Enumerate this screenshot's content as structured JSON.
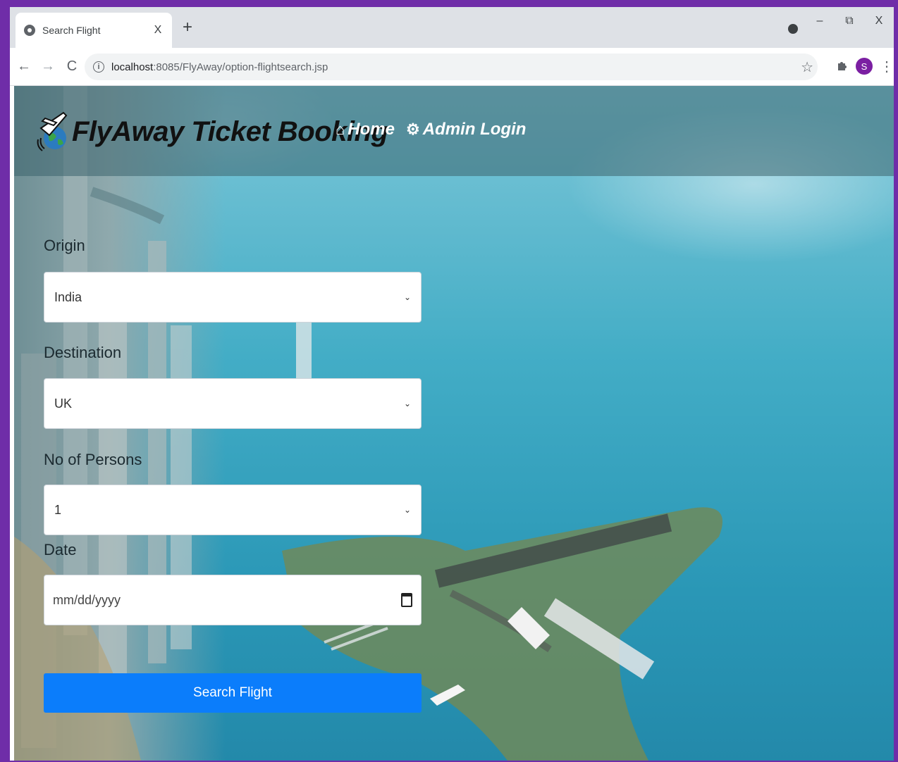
{
  "browser": {
    "tab_title": "Search Flight",
    "tab_close": "X",
    "new_tab": "+",
    "url_host": "localhost",
    "url_path": ":8085/FlyAway/option-flightsearch.jsp",
    "avatar_letter": "S",
    "window_controls": {
      "minimize": "–",
      "restore": "⧉",
      "close": "X"
    },
    "nav": {
      "back": "←",
      "forward": "→",
      "reload": "C"
    }
  },
  "header": {
    "brand": "FlyAway Ticket Booking",
    "links": [
      {
        "icon": "home-icon",
        "label": "Home"
      },
      {
        "icon": "gear-icon",
        "label": "Admin Login"
      }
    ]
  },
  "form": {
    "origin": {
      "label": "Origin",
      "value": "India"
    },
    "destination": {
      "label": "Destination",
      "value": "UK"
    },
    "persons": {
      "label": "No of Persons",
      "value": "1"
    },
    "date": {
      "label": "Date",
      "placeholder": "mm/dd/yyyy"
    },
    "submit_label": "Search Flight"
  },
  "colors": {
    "frame": "#6f2da8",
    "button": "#0b7dfb",
    "avatar": "#7b1fa2"
  }
}
